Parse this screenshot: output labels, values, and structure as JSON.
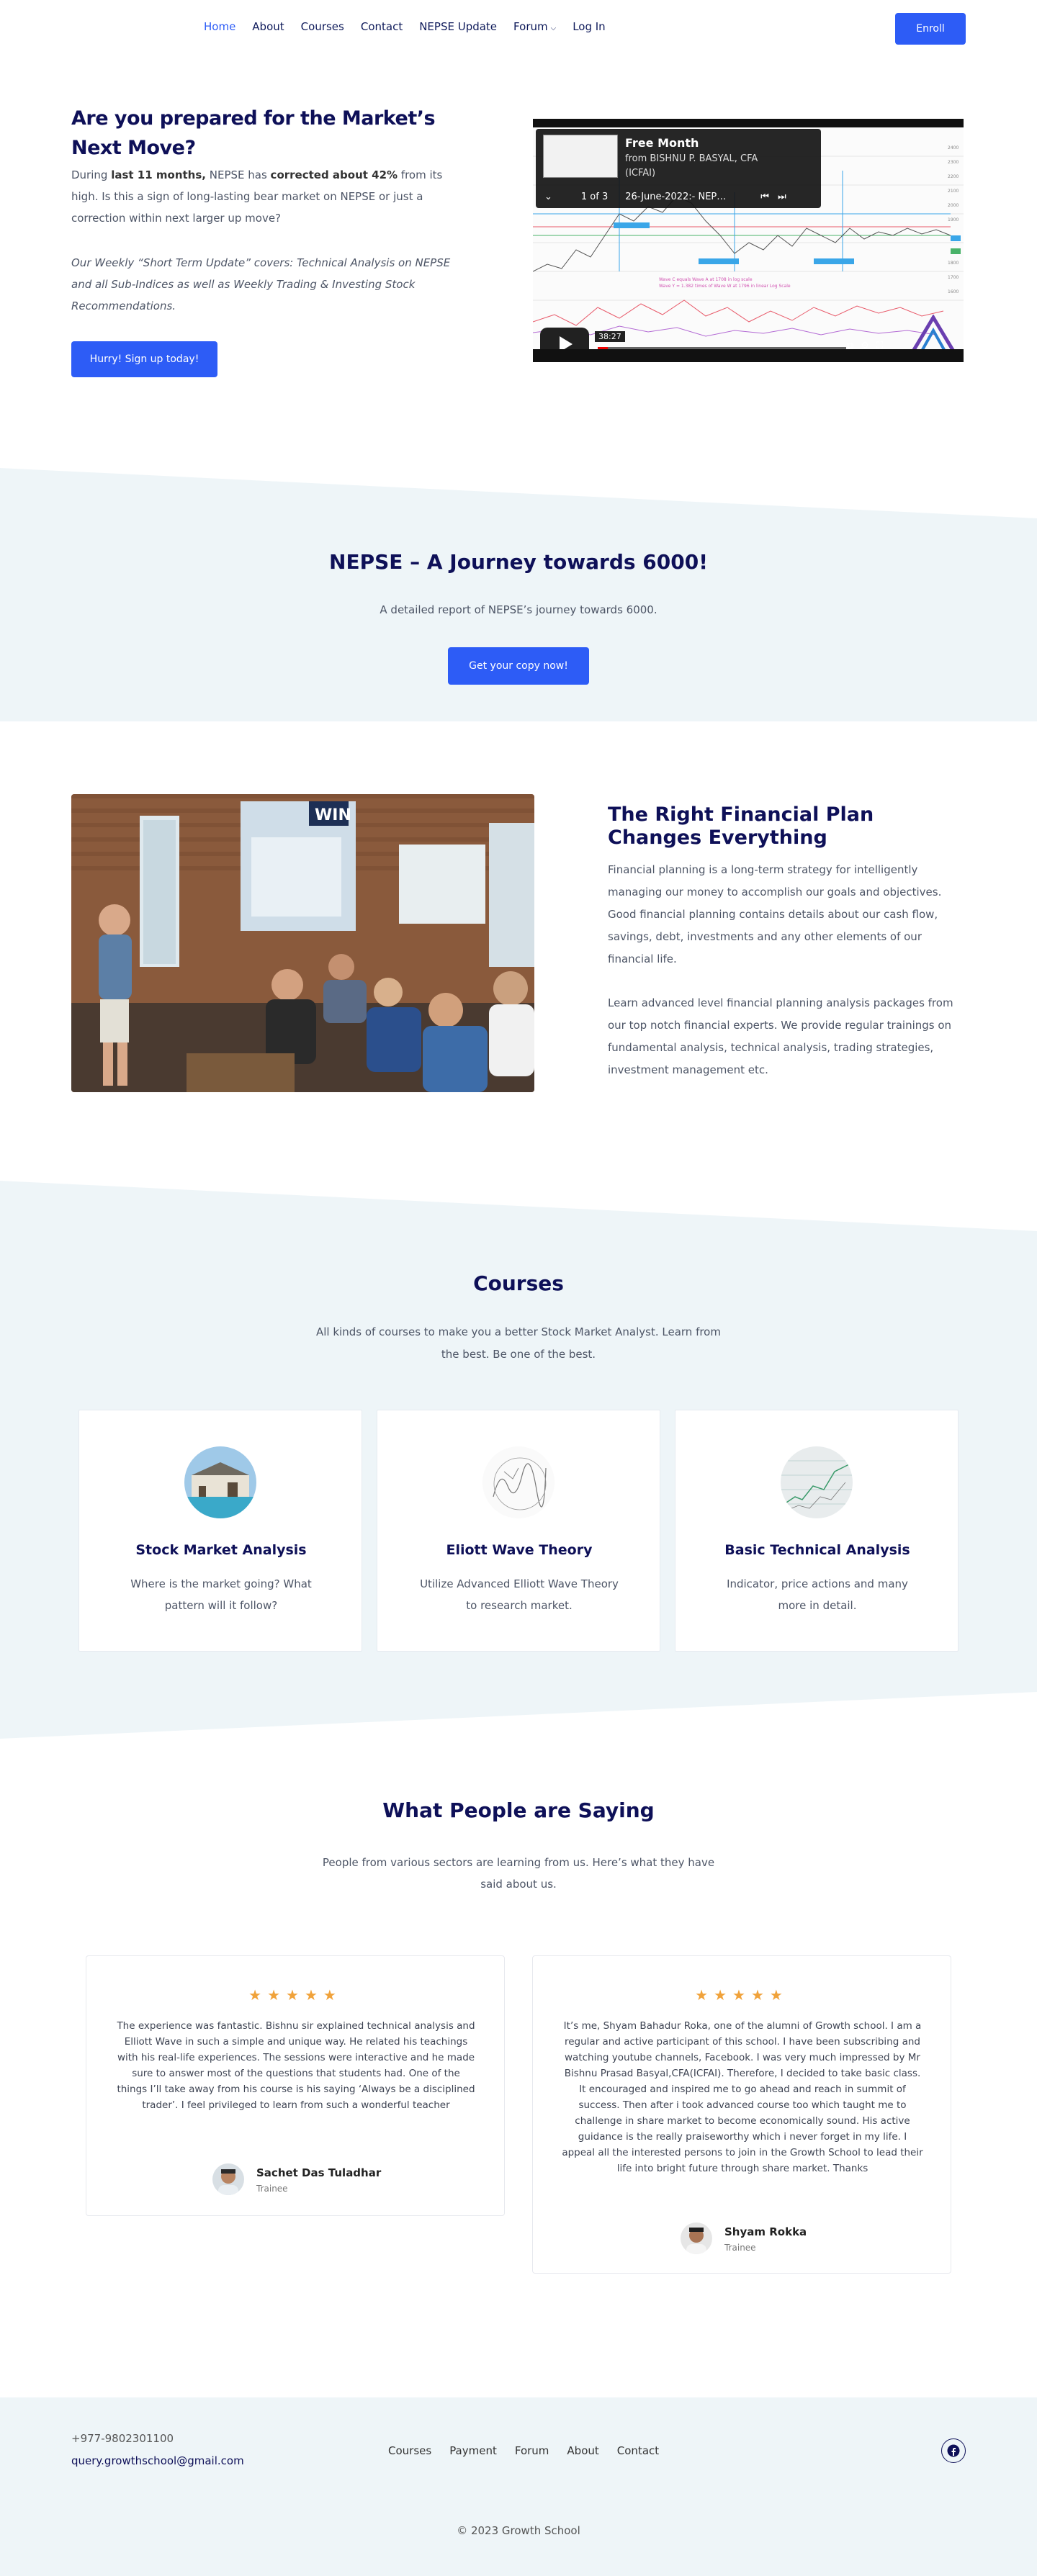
{
  "nav": {
    "items": [
      "Home",
      "About",
      "Courses",
      "Contact",
      "NEPSE Update",
      "Forum",
      "Log In"
    ],
    "enroll": "Enroll"
  },
  "hero": {
    "title": "Are you prepared for the Market’s Next Move?",
    "p1_pre": "During ",
    "p1_b1": "last 11 months,",
    "p1_mid": " NEPSE has ",
    "p1_b2": "corrected about 42%",
    "p1_post": " from its high. Is this a sign of long-lasting bear market on NEPSE or just a correction within next larger up move?",
    "p2": "Our Weekly “Short Term Update” covers: Technical Analysis on NEPSE and all Sub-Indices as well as Weekly Trading & Investing Stock Recommendations.",
    "button": "Hurry! Sign up today!"
  },
  "video": {
    "title": "Free Month",
    "from": "from BISHNU P. BASYAL, CFA (ICFAI)",
    "counter": "1 of 3",
    "episode": "26-June-2022:- NEP…",
    "time": "38:27",
    "progress": 0.04
  },
  "journey": {
    "title": "NEPSE – A Journey towards 6000!",
    "subtitle": "A detailed report of NEPSE’s journey towards 6000.",
    "button": "Get your copy now!"
  },
  "plan": {
    "title": "The Right Financial Plan Changes Everything",
    "p1": "Financial planning is a long-term strategy for intelligently managing our money to accomplish our goals and objectives. Good financial planning contains details about our cash flow, savings, debt, investments and any other elements of our financial life.",
    "p2": "Learn advanced level financial planning analysis packages from our top notch financial experts. We provide regular trainings on fundamental analysis, technical analysis, trading strategies, investment management etc.",
    "image_sign": "WIN"
  },
  "courses": {
    "title": "Courses",
    "subtitle": "All kinds of courses to make you a better Stock Market Analyst. Learn from the best. Be one of the best.",
    "items": [
      {
        "name": "Stock Market Analysis",
        "desc": "Where is the market going? What pattern will it follow?"
      },
      {
        "name": "Eliott Wave Theory",
        "desc": "Utilize Advanced Elliott Wave Theory to research market."
      },
      {
        "name": "Basic Technical Analysis",
        "desc": "Indicator, price actions and many more in detail."
      }
    ]
  },
  "testimonials": {
    "title": "What People are Saying",
    "subtitle": "People from various sectors are learning from us. Here’s what they have said about us.",
    "stars": "★★★★★",
    "items": [
      {
        "text": "The experience was fantastic. Bishnu sir explained technical analysis and Elliott Wave in such a simple and unique way. He related his teachings with his real-life experiences. The sessions were interactive and he made sure to answer most of the questions that students had. One of the things I’ll take away from his course is his saying ‘Always be a disciplined trader’. I feel privileged to learn from such a wonderful teacher",
        "name": "Sachet Das Tuladhar",
        "role": "Trainee"
      },
      {
        "text": "It’s me, Shyam Bahadur Roka, one of the alumni of Growth school. I am a regular and active participant of this school. I have been subscribing and watching youtube channels, Facebook. I was very much impressed by Mr Bishnu Prasad Basyal,CFA(ICFAI). Therefore, I decided to take basic class. It encouraged and inspired me to go ahead and reach in summit of success. Then after i took advanced course too which taught me to challenge in share market to become economically sound. His active guidance is the really praiseworthy which i never forget in my life. I appeal all the interested persons to join in the Growth School to lead their life into bright future through share market. Thanks",
        "name": "Shyam Rokka",
        "role": "Trainee"
      }
    ]
  },
  "footer": {
    "phone": "+977-9802301100",
    "email": "query.growthschool@gmail.com",
    "links": [
      "Courses",
      "Payment",
      "Forum",
      "About",
      "Contact"
    ],
    "copyright": "© 2023 Growth School"
  }
}
